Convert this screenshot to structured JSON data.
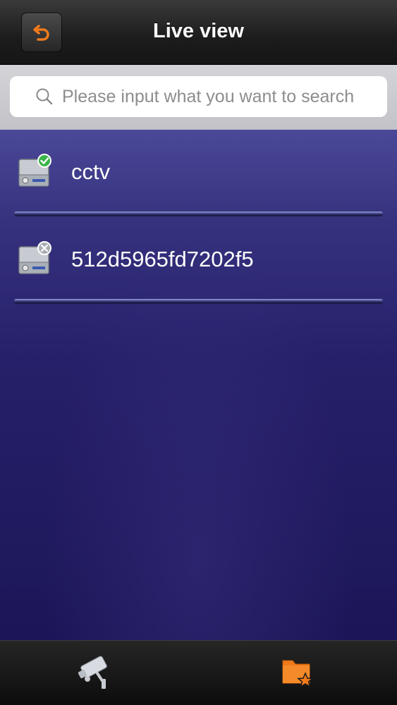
{
  "header": {
    "title": "Live view",
    "back_icon": "back-arrow-icon",
    "accent_color": "#f07a1a"
  },
  "search": {
    "placeholder": "Please input what you want to search",
    "value": "",
    "icon": "search-icon"
  },
  "devices": [
    {
      "name": "cctv",
      "status": "online",
      "status_icon": "check-badge-icon"
    },
    {
      "name": "512d5965fd7202f5",
      "status": "offline",
      "status_icon": "x-badge-icon"
    }
  ],
  "tabbar": {
    "tabs": [
      {
        "icon": "cctv-camera-icon",
        "selected": false
      },
      {
        "icon": "favorite-folder-icon",
        "selected": true
      }
    ]
  }
}
